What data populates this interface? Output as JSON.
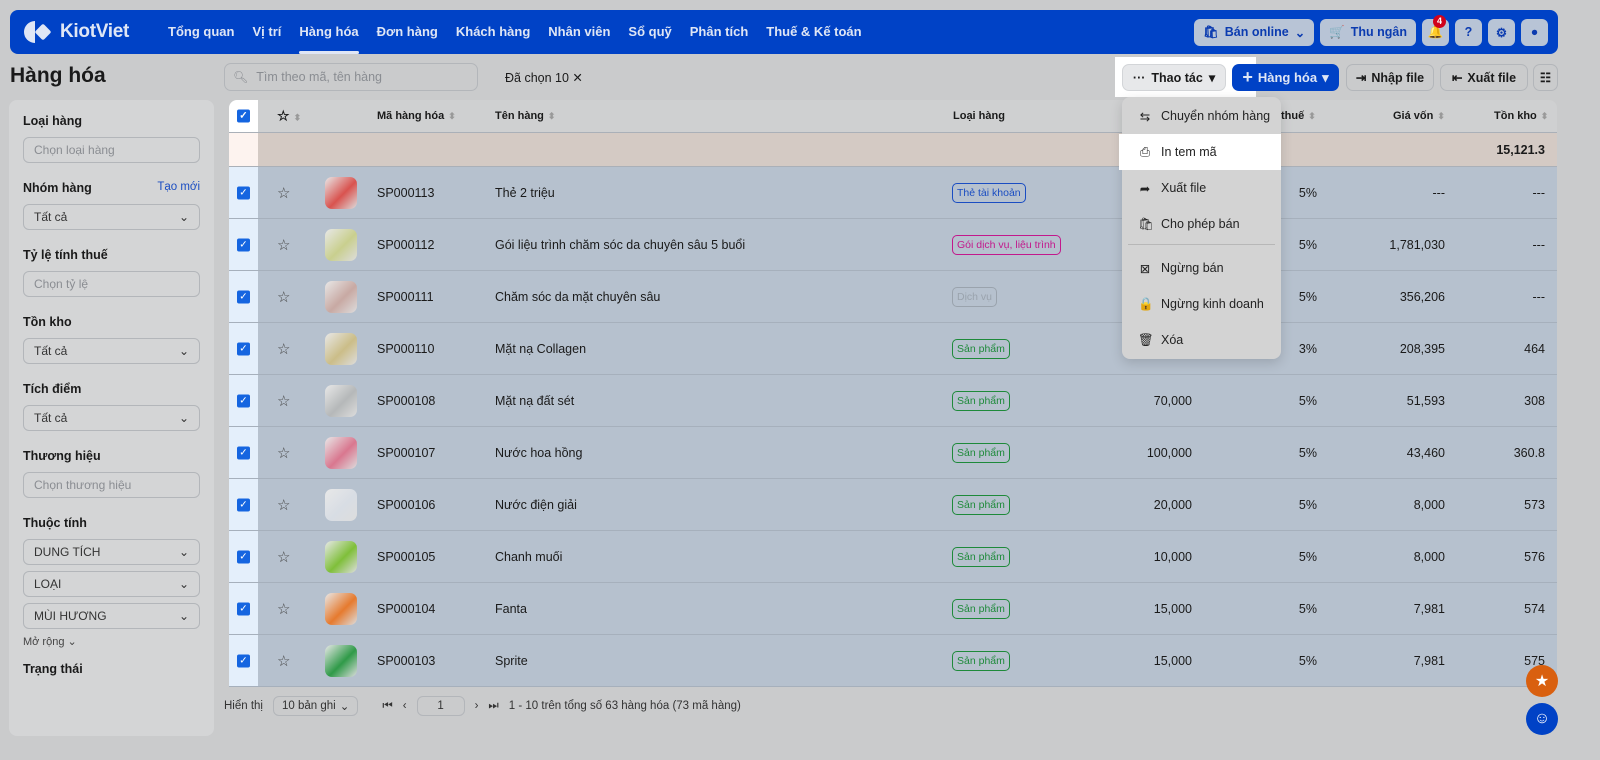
{
  "nav": {
    "brand": "KiotViet",
    "items": [
      "Tổng quan",
      "Vị trí",
      "Hàng hóa",
      "Đơn hàng",
      "Khách hàng",
      "Nhân viên",
      "Sổ quỹ",
      "Phân tích",
      "Thuế & Kế toán"
    ],
    "active_index": 2,
    "online_label": "Bán online",
    "cashier_label": "Thu ngân",
    "notification_count": "4"
  },
  "page": {
    "title": "Hàng hóa",
    "search_placeholder": "Tìm theo mã, tên hàng",
    "selected_label": "Đã chọn 10",
    "actions_label": "Thao tác",
    "add_label": "Hàng hóa",
    "import_label": "Nhập file",
    "export_label": "Xuất file"
  },
  "menu": {
    "items": [
      {
        "label": "Chuyển nhóm hàng",
        "icon": "move-group-icon"
      },
      {
        "label": "In tem mã",
        "icon": "printer-icon",
        "highlighted": true
      },
      {
        "label": "Xuất file",
        "icon": "share-icon"
      },
      {
        "label": "Cho phép bán",
        "icon": "bag-icon"
      },
      {
        "label": "Ngừng bán",
        "icon": "bag-x-icon"
      },
      {
        "label": "Ngừng kinh doanh",
        "icon": "lock-icon"
      },
      {
        "label": "Xóa",
        "icon": "trash-icon"
      }
    ]
  },
  "sidebar": {
    "loai_hang": {
      "label": "Loại hàng",
      "placeholder": "Chọn loại hàng"
    },
    "nhom_hang": {
      "label": "Nhóm hàng",
      "link": "Tạo mới",
      "value": "Tất cả"
    },
    "ty_le_thue": {
      "label": "Tỷ lệ tính thuế",
      "placeholder": "Chọn tỷ lệ"
    },
    "ton_kho": {
      "label": "Tồn kho",
      "value": "Tất cả"
    },
    "tich_diem": {
      "label": "Tích điểm",
      "value": "Tất cả"
    },
    "thuong_hieu": {
      "label": "Thương hiệu",
      "placeholder": "Chọn thương hiệu"
    },
    "thuoc_tinh": {
      "label": "Thuộc tính",
      "values": [
        "DUNG TÍCH",
        "LOẠI",
        "MÙI HƯƠNG"
      ]
    },
    "more_label": "Mở rộng",
    "trang_thai": {
      "label": "Trạng thái"
    }
  },
  "table": {
    "headers": {
      "code": "Mã hàng hóa",
      "name": "Tên hàng",
      "type": "Loại hàng",
      "tax": "thuế",
      "cost": "Giá vốn",
      "stock": "Tồn kho"
    },
    "summary_stock": "15,121.3",
    "rows": [
      {
        "code": "SP000113",
        "name": "Thẻ 2 triệu",
        "type": "Thẻ tài khoản",
        "type_color": "#1a4dc2",
        "price": "",
        "tax": "5%",
        "cost": "---",
        "stock": "---",
        "thumb": "#d9534f"
      },
      {
        "code": "SP000112",
        "name": "Gói liệu trình chăm sóc da chuyên sâu 5 buổi",
        "type": "Gói dịch vụ, liệu trình",
        "type_color": "#c2188c",
        "price": "",
        "tax": "5%",
        "cost": "1,781,030",
        "stock": "---",
        "thumb": "#c9cf8e"
      },
      {
        "code": "SP000111",
        "name": "Chăm sóc da mặt chuyên sâu",
        "type": "Dịch vụ",
        "type_color": "#9aa3ad",
        "price": "",
        "tax": "5%",
        "cost": "356,206",
        "stock": "---",
        "thumb": "#c8a9a3"
      },
      {
        "code": "SP000110",
        "name": "Mặt nạ Collagen",
        "type": "Sản phẩm",
        "type_color": "#1e8a3a",
        "price": "",
        "tax": "3%",
        "cost": "208,395",
        "stock": "464",
        "thumb": "#cbbd88"
      },
      {
        "code": "SP000108",
        "name": "Mặt nạ đất sét",
        "type": "Sản phẩm",
        "type_color": "#1e8a3a",
        "price": "70,000",
        "tax": "5%",
        "cost": "51,593",
        "stock": "308",
        "thumb": "#b5b8b9"
      },
      {
        "code": "SP000107",
        "name": "Nước hoa hồng",
        "type": "Sản phẩm",
        "type_color": "#1e8a3a",
        "price": "100,000",
        "tax": "5%",
        "cost": "43,460",
        "stock": "360.8",
        "thumb": "#d9778f"
      },
      {
        "code": "SP000106",
        "name": "Nước điện giải",
        "type": "Sản phẩm",
        "type_color": "#1e8a3a",
        "price": "20,000",
        "tax": "5%",
        "cost": "8,000",
        "stock": "573",
        "thumb": "#d8dde4"
      },
      {
        "code": "SP000105",
        "name": "Chanh muối",
        "type": "Sản phẩm",
        "type_color": "#1e8a3a",
        "price": "10,000",
        "tax": "5%",
        "cost": "8,000",
        "stock": "576",
        "thumb": "#7fbf3a"
      },
      {
        "code": "SP000104",
        "name": "Fanta",
        "type": "Sản phẩm",
        "type_color": "#1e8a3a",
        "price": "15,000",
        "tax": "5%",
        "cost": "7,981",
        "stock": "574",
        "thumb": "#e67a2e"
      },
      {
        "code": "SP000103",
        "name": "Sprite",
        "type": "Sản phẩm",
        "type_color": "#1e8a3a",
        "price": "15,000",
        "tax": "5%",
        "cost": "7,981",
        "stock": "575",
        "thumb": "#2f9a48"
      }
    ]
  },
  "footer": {
    "show_label": "Hiển thị",
    "page_size": "10 bản ghi",
    "page": "1",
    "summary": "1 - 10 trên tổng số 63 hàng hóa (73 mã hàng)"
  },
  "colors": {
    "brand": "#0046d5",
    "accent_fab": "#e0640f"
  }
}
